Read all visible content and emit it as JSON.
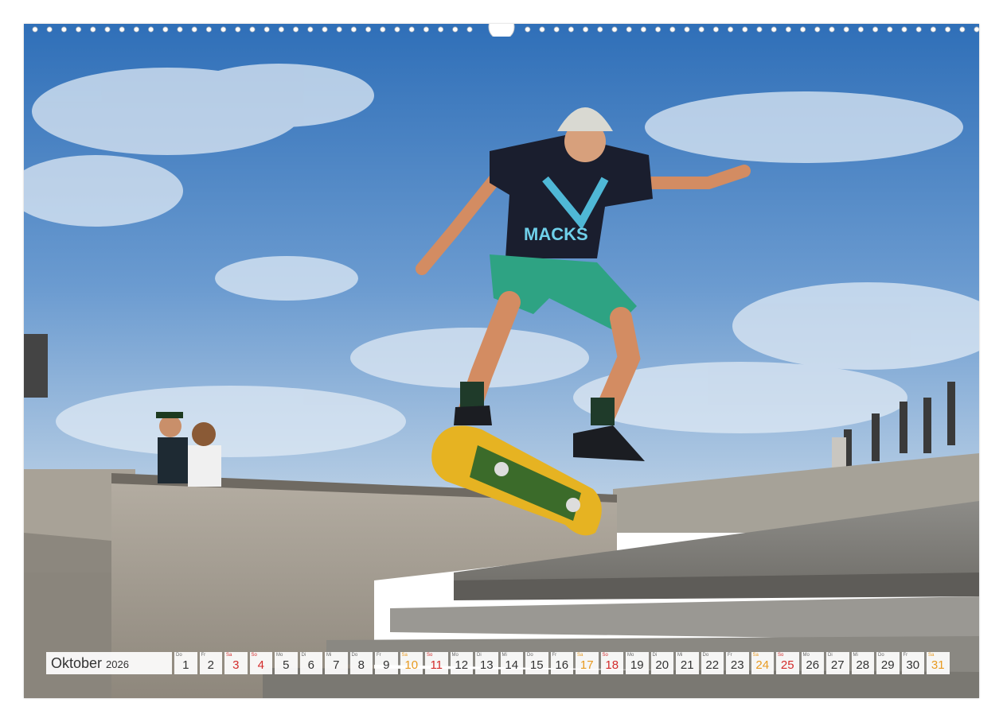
{
  "calendar": {
    "month": "Oktober",
    "year": "2026",
    "days": [
      {
        "abbr": "Do",
        "num": "1",
        "kind": "week"
      },
      {
        "abbr": "Fr",
        "num": "2",
        "kind": "week"
      },
      {
        "abbr": "Sa",
        "num": "3",
        "kind": "sun"
      },
      {
        "abbr": "So",
        "num": "4",
        "kind": "sun"
      },
      {
        "abbr": "Mo",
        "num": "5",
        "kind": "week"
      },
      {
        "abbr": "Di",
        "num": "6",
        "kind": "week"
      },
      {
        "abbr": "Mi",
        "num": "7",
        "kind": "week"
      },
      {
        "abbr": "Do",
        "num": "8",
        "kind": "week"
      },
      {
        "abbr": "Fr",
        "num": "9",
        "kind": "week"
      },
      {
        "abbr": "Sa",
        "num": "10",
        "kind": "sat"
      },
      {
        "abbr": "So",
        "num": "11",
        "kind": "sun"
      },
      {
        "abbr": "Mo",
        "num": "12",
        "kind": "week"
      },
      {
        "abbr": "Di",
        "num": "13",
        "kind": "week"
      },
      {
        "abbr": "Mi",
        "num": "14",
        "kind": "week"
      },
      {
        "abbr": "Do",
        "num": "15",
        "kind": "week"
      },
      {
        "abbr": "Fr",
        "num": "16",
        "kind": "week"
      },
      {
        "abbr": "Sa",
        "num": "17",
        "kind": "sat"
      },
      {
        "abbr": "So",
        "num": "18",
        "kind": "sun"
      },
      {
        "abbr": "Mo",
        "num": "19",
        "kind": "week"
      },
      {
        "abbr": "Di",
        "num": "20",
        "kind": "week"
      },
      {
        "abbr": "Mi",
        "num": "21",
        "kind": "week"
      },
      {
        "abbr": "Do",
        "num": "22",
        "kind": "week"
      },
      {
        "abbr": "Fr",
        "num": "23",
        "kind": "week"
      },
      {
        "abbr": "Sa",
        "num": "24",
        "kind": "sat"
      },
      {
        "abbr": "So",
        "num": "25",
        "kind": "sun"
      },
      {
        "abbr": "Mo",
        "num": "26",
        "kind": "week"
      },
      {
        "abbr": "Di",
        "num": "27",
        "kind": "week"
      },
      {
        "abbr": "Mi",
        "num": "28",
        "kind": "week"
      },
      {
        "abbr": "Do",
        "num": "29",
        "kind": "week"
      },
      {
        "abbr": "Fr",
        "num": "30",
        "kind": "week"
      },
      {
        "abbr": "Sa",
        "num": "31",
        "kind": "sat"
      }
    ]
  },
  "photo": {
    "shirt_text": "MACKS",
    "colors": {
      "sky_top": "#2f6fb8",
      "sky_bottom": "#a9c6e3",
      "concrete": "#9a958d",
      "shorts": "#2ea383",
      "board": "#e6b322"
    }
  }
}
